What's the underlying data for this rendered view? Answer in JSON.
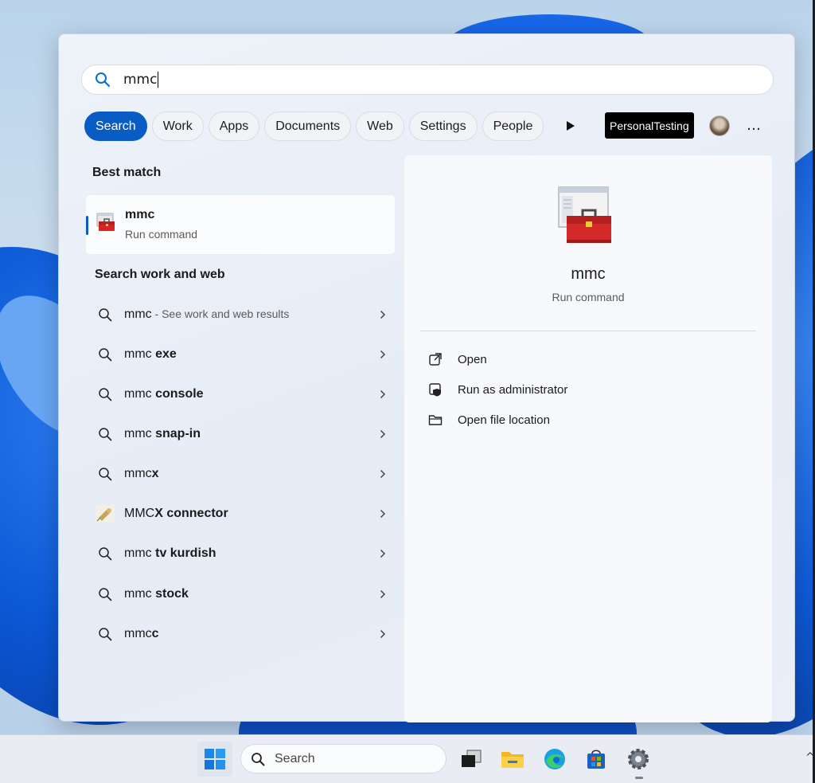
{
  "search": {
    "query": "mmc"
  },
  "filters": [
    "Search",
    "Work",
    "Apps",
    "Documents",
    "Web",
    "Settings",
    "People"
  ],
  "account": {
    "label": "PersonalTesting"
  },
  "more_icon": "…",
  "best_match": {
    "heading": "Best match",
    "name": "mmc",
    "type": "Run command",
    "icon": "toolbox-icon"
  },
  "web": {
    "heading": "Search work and web",
    "items": [
      {
        "prefix": "mmc",
        "bold": "",
        "hint": " - See work and web results",
        "icon": "search-icon"
      },
      {
        "prefix": "mmc ",
        "bold": "exe",
        "hint": "",
        "icon": "search-icon"
      },
      {
        "prefix": "mmc ",
        "bold": "console",
        "hint": "",
        "icon": "search-icon"
      },
      {
        "prefix": "mmc ",
        "bold": "snap-in",
        "hint": "",
        "icon": "search-icon"
      },
      {
        "prefix": "mmc",
        "bold": "x",
        "hint": "",
        "icon": "search-icon"
      },
      {
        "prefix": "MMC",
        "bold": "X connector",
        "hint": "",
        "icon": "connector-image-icon"
      },
      {
        "prefix": "mmc ",
        "bold": "tv kurdish",
        "hint": "",
        "icon": "search-icon"
      },
      {
        "prefix": "mmc ",
        "bold": "stock",
        "hint": "",
        "icon": "search-icon"
      },
      {
        "prefix": "mmc",
        "bold": "c",
        "hint": "",
        "icon": "search-icon"
      }
    ]
  },
  "detail": {
    "name": "mmc",
    "type": "Run command",
    "actions": [
      {
        "label": "Open",
        "icon": "open-external-icon"
      },
      {
        "label": "Run as administrator",
        "icon": "shield-icon"
      },
      {
        "label": "Open file location",
        "icon": "folder-icon"
      }
    ]
  },
  "taskbar": {
    "search_label": "Search",
    "apps": [
      "task-view-icon",
      "file-explorer-icon",
      "edge-icon",
      "store-icon",
      "settings-icon"
    ]
  },
  "colors": {
    "accent": "#0a5cc5",
    "panel_bg": "#e9eef7"
  }
}
